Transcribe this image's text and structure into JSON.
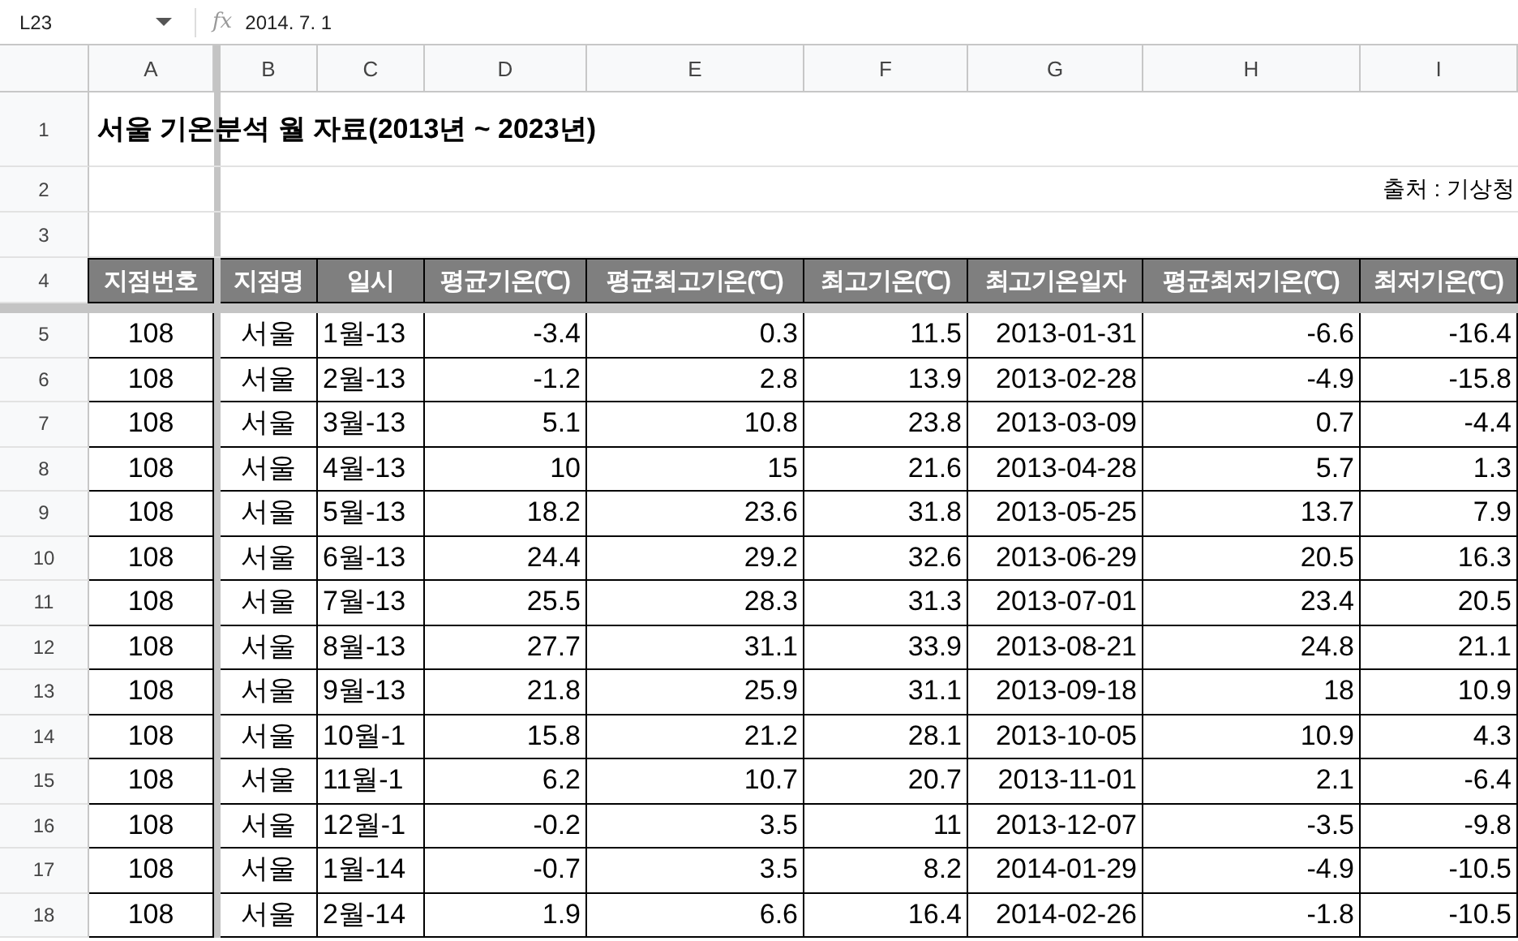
{
  "formula_bar": {
    "cell_ref": "L23",
    "fx": "fx",
    "value": "2014. 7. 1"
  },
  "columns": [
    "A",
    "B",
    "C",
    "D",
    "E",
    "F",
    "G",
    "H",
    "I"
  ],
  "title_row": {
    "number": "1",
    "text": "서울 기온분석 월 자료(2013년 ~ 2023년)"
  },
  "source_row": {
    "number": "2",
    "text": "출처 : 기상청"
  },
  "blank_rows": [
    "3"
  ],
  "header_row": {
    "number": "4",
    "cells": [
      "지점번호",
      "지점명",
      "일시",
      "평균기온(℃)",
      "평균최고기온(℃)",
      "최고기온(℃)",
      "최고기온일자",
      "평균최저기온(℃)",
      "최저기온(℃)"
    ]
  },
  "data_rows": [
    {
      "number": "5",
      "cells": [
        "108",
        "서울",
        "1월-13",
        "-3.4",
        "0.3",
        "11.5",
        "2013-01-31",
        "-6.6",
        "-16.4"
      ]
    },
    {
      "number": "6",
      "cells": [
        "108",
        "서울",
        "2월-13",
        "-1.2",
        "2.8",
        "13.9",
        "2013-02-28",
        "-4.9",
        "-15.8"
      ]
    },
    {
      "number": "7",
      "cells": [
        "108",
        "서울",
        "3월-13",
        "5.1",
        "10.8",
        "23.8",
        "2013-03-09",
        "0.7",
        "-4.4"
      ]
    },
    {
      "number": "8",
      "cells": [
        "108",
        "서울",
        "4월-13",
        "10",
        "15",
        "21.6",
        "2013-04-28",
        "5.7",
        "1.3"
      ]
    },
    {
      "number": "9",
      "cells": [
        "108",
        "서울",
        "5월-13",
        "18.2",
        "23.6",
        "31.8",
        "2013-05-25",
        "13.7",
        "7.9"
      ]
    },
    {
      "number": "10",
      "cells": [
        "108",
        "서울",
        "6월-13",
        "24.4",
        "29.2",
        "32.6",
        "2013-06-29",
        "20.5",
        "16.3"
      ]
    },
    {
      "number": "11",
      "cells": [
        "108",
        "서울",
        "7월-13",
        "25.5",
        "28.3",
        "31.3",
        "2013-07-01",
        "23.4",
        "20.5"
      ]
    },
    {
      "number": "12",
      "cells": [
        "108",
        "서울",
        "8월-13",
        "27.7",
        "31.1",
        "33.9",
        "2013-08-21",
        "24.8",
        "21.1"
      ]
    },
    {
      "number": "13",
      "cells": [
        "108",
        "서울",
        "9월-13",
        "21.8",
        "25.9",
        "31.1",
        "2013-09-18",
        "18",
        "10.9"
      ]
    },
    {
      "number": "14",
      "cells": [
        "108",
        "서울",
        "10월-1",
        "15.8",
        "21.2",
        "28.1",
        "2013-10-05",
        "10.9",
        "4.3"
      ]
    },
    {
      "number": "15",
      "cells": [
        "108",
        "서울",
        "11월-1",
        "6.2",
        "10.7",
        "20.7",
        "2013-11-01",
        "2.1",
        "-6.4"
      ]
    },
    {
      "number": "16",
      "cells": [
        "108",
        "서울",
        "12월-1",
        "-0.2",
        "3.5",
        "11",
        "2013-12-07",
        "-3.5",
        "-9.8"
      ]
    },
    {
      "number": "17",
      "cells": [
        "108",
        "서울",
        "1월-14",
        "-0.7",
        "3.5",
        "8.2",
        "2014-01-29",
        "-4.9",
        "-10.5"
      ]
    },
    {
      "number": "18",
      "cells": [
        "108",
        "서울",
        "2월-14",
        "1.9",
        "6.6",
        "16.4",
        "2014-02-26",
        "-1.8",
        "-10.5"
      ]
    }
  ]
}
